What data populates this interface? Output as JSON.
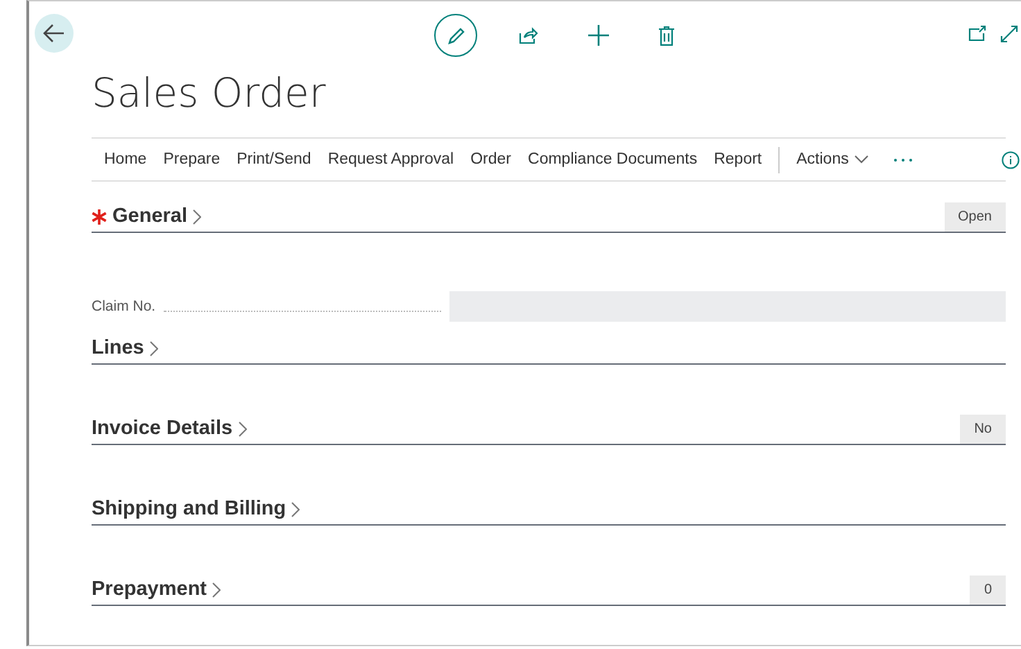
{
  "page": {
    "title": "Sales Order"
  },
  "actions": [
    {
      "label": "Home"
    },
    {
      "label": "Prepare"
    },
    {
      "label": "Print/Send"
    },
    {
      "label": "Request Approval"
    },
    {
      "label": "Order"
    },
    {
      "label": "Compliance Documents"
    },
    {
      "label": "Report"
    }
  ],
  "actions_menu": {
    "label": "Actions"
  },
  "sections": [
    {
      "title": "General",
      "required": true,
      "badge": "Open",
      "fields": [
        {
          "label": "Claim No."
        }
      ]
    },
    {
      "title": "Lines",
      "required": false
    },
    {
      "title": "Invoice Details",
      "required": false,
      "badge": "No"
    },
    {
      "title": "Shipping and Billing",
      "required": false
    },
    {
      "title": "Prepayment",
      "required": false,
      "badge": "0"
    }
  ]
}
